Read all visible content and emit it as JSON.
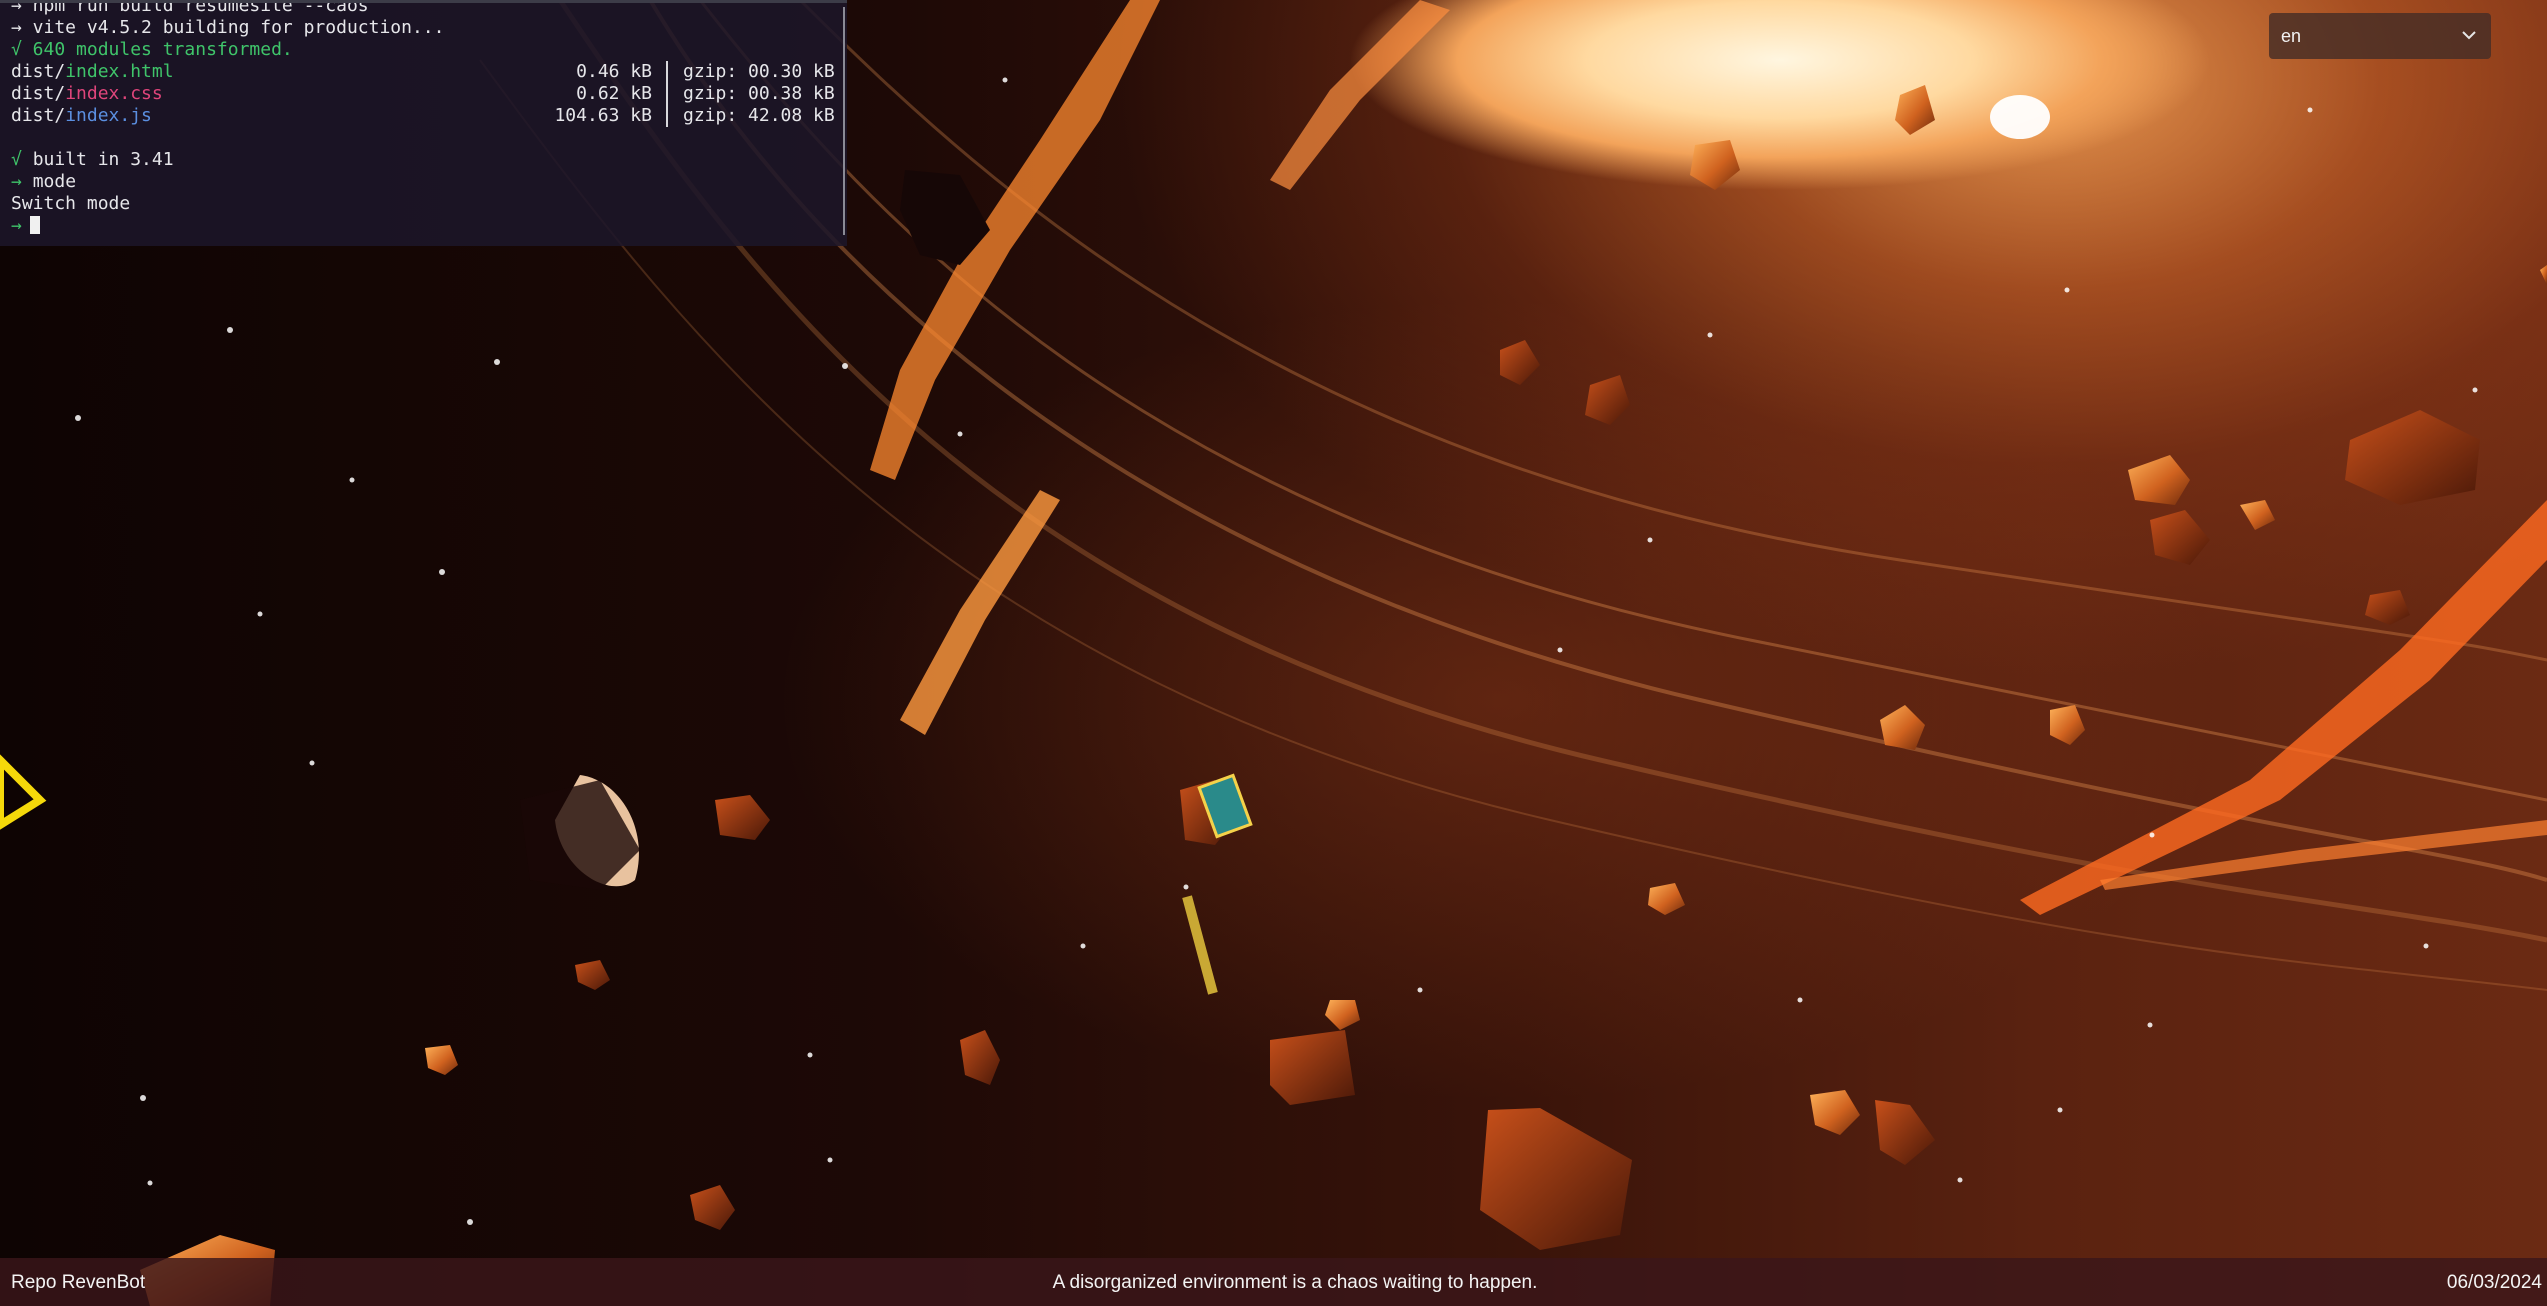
{
  "terminal": {
    "lines": [
      "→ npm run build resumesite --caos",
      "→ vite v4.5.2 building for production...",
      "√ 640 modules transformed."
    ],
    "files": [
      {
        "dir": "dist/",
        "name": "index.html",
        "color": "#3fc46a",
        "size": "0.46 kB",
        "gzip": "gzip: 00.30 kB"
      },
      {
        "dir": "dist/",
        "name": "index.css",
        "color": "#e0457b",
        "size": "0.62 kB",
        "gzip": "gzip: 00.38 kB"
      },
      {
        "dir": "dist/",
        "name": "index.js",
        "color": "#5b8fe0",
        "size": "104.63 kB",
        "gzip": "gzip: 42.08 kB"
      }
    ],
    "built_check": "√",
    "built_text": "built in 3.41",
    "mode_arrow": "→",
    "mode_cmd": "mode",
    "switch_text": "Switch mode",
    "prompt_arrow": "→"
  },
  "language_select": {
    "value": "en",
    "icon": "chevron-down-icon"
  },
  "footer": {
    "left": "Repo RevenBot",
    "center": "A disorganized environment is a chaos waiting to happen.",
    "right": "06/03/2024"
  },
  "colors": {
    "terminal_bg": "#1c162a",
    "footer_bg": "#3a161a",
    "accent_green": "#3fc46a",
    "accent_pink": "#e0457b",
    "accent_blue": "#5b8fe0",
    "asteroid_orange": "#e8742a"
  }
}
